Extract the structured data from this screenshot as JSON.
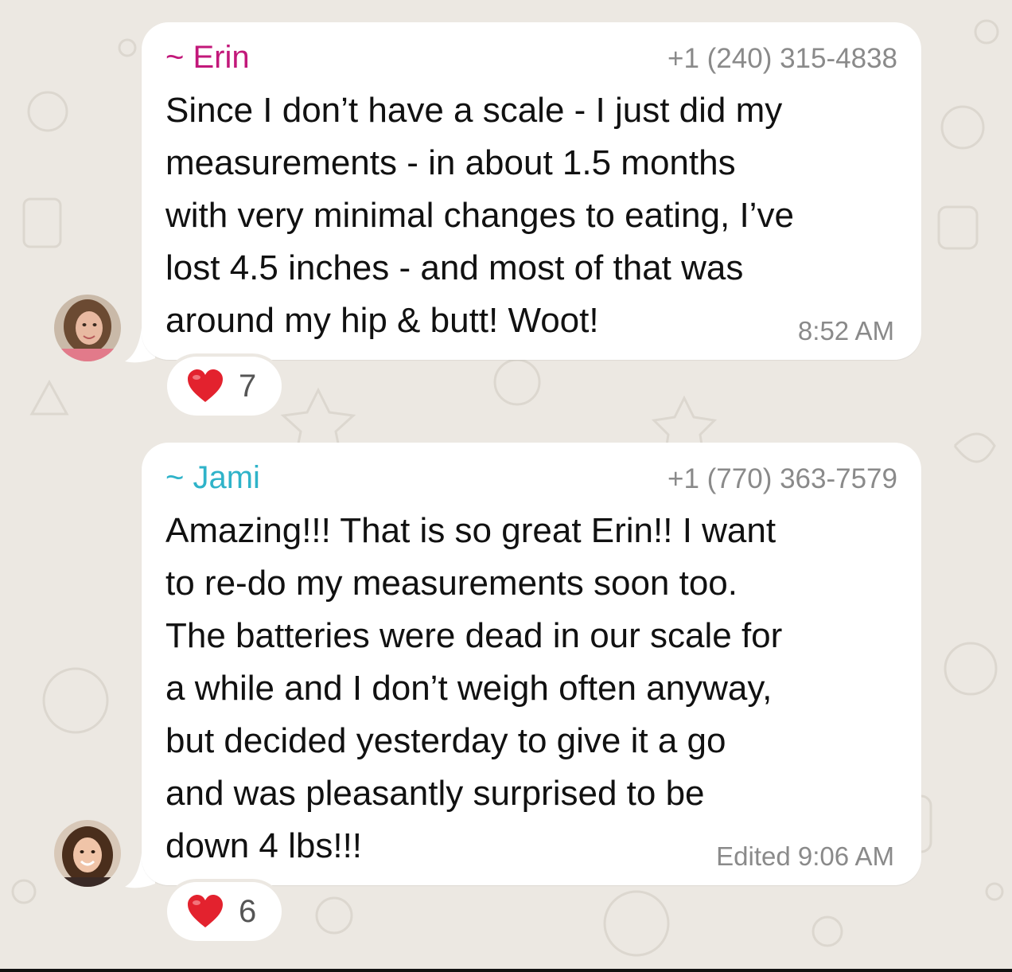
{
  "colors": {
    "background": "#ece8e2",
    "bubble": "#ffffff",
    "erin_name": "#c2187a",
    "jami_name": "#2fb3c9",
    "meta_text": "#8a8a8a"
  },
  "messages": [
    {
      "sender": "~ Erin",
      "phone": "+1 (240) 315-4838",
      "lines": [
        "Since I don’t have a scale - I just did my",
        "measurements - in about 1.5 months",
        "with very minimal changes to eating, I’ve",
        "lost 4.5 inches - and most of that was",
        "around my hip & butt! Woot!"
      ],
      "time": "8:52 AM",
      "reaction": {
        "icon": "heart-icon",
        "count": "7"
      }
    },
    {
      "sender": "~ Jami",
      "phone": "+1 (770) 363-7579",
      "lines": [
        "Amazing!!!  That is so great Erin!!  I want",
        "to re-do my measurements soon too.",
        "The batteries were dead in our scale for",
        "a while and I don’t weigh often anyway,",
        "but decided yesterday to give it a go",
        "and was pleasantly surprised to be",
        "down 4 lbs!!!"
      ],
      "time": "Edited 9:06 AM",
      "reaction": {
        "icon": "heart-icon",
        "count": "6"
      }
    }
  ]
}
